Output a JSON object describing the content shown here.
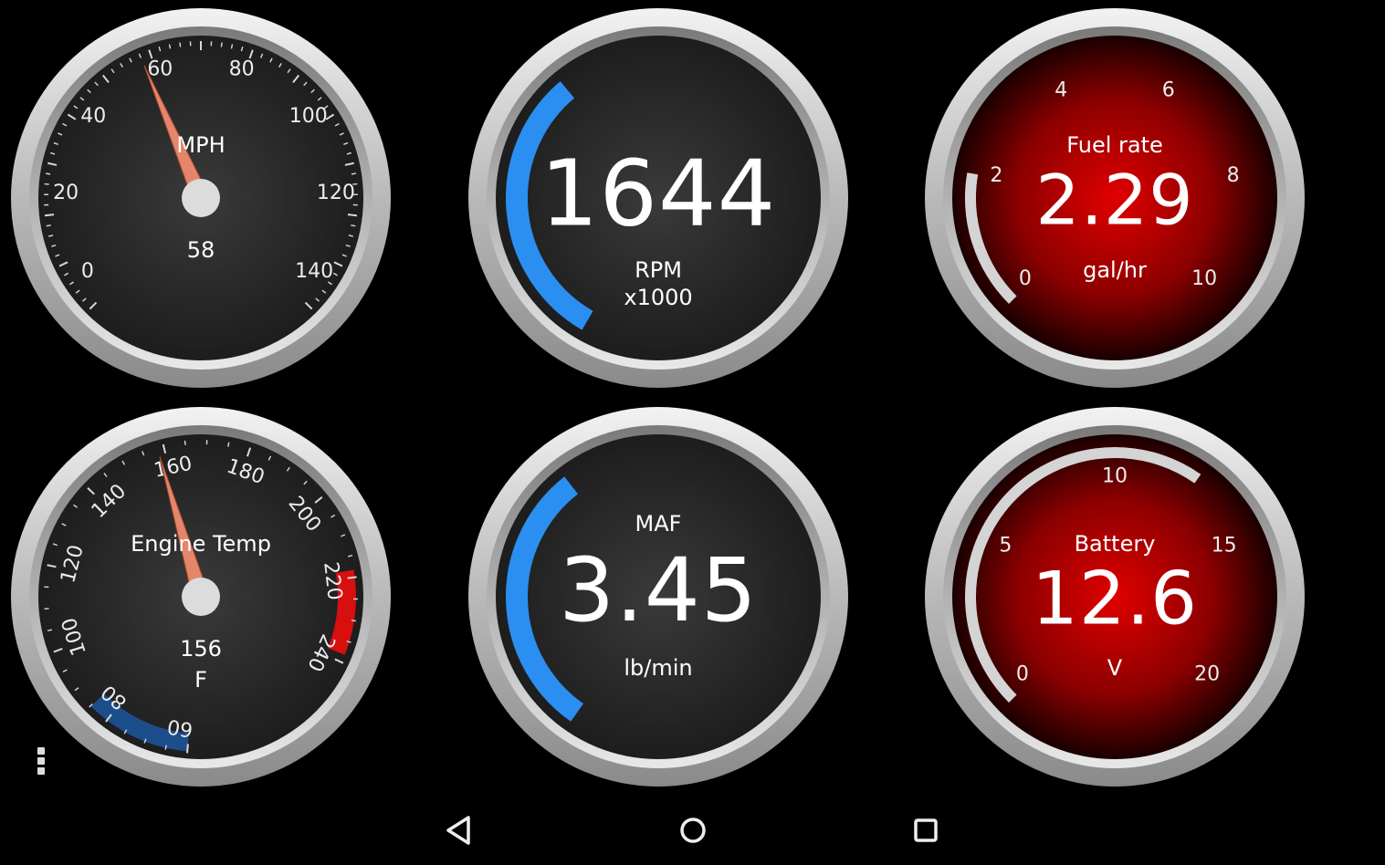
{
  "gauges": {
    "speed": {
      "label": "MPH",
      "value": "58",
      "value_numeric": 58,
      "scale_min": 0,
      "scale_max": 140,
      "ticks": [
        "0",
        "20",
        "40",
        "60",
        "80",
        "100",
        "120",
        "140"
      ]
    },
    "rpm": {
      "value": "1644",
      "unit": "RPM",
      "multiplier": "x1000",
      "arc_fraction": 0.27
    },
    "fuel": {
      "label": "Fuel rate",
      "value": "2.29",
      "unit": "gal/hr",
      "ticks": [
        "0",
        "2",
        "4",
        "6",
        "8",
        "10"
      ],
      "value_numeric": 2.29,
      "scale_min": 0,
      "scale_max": 10
    },
    "engine_temp": {
      "label": "Engine Temp",
      "value": "156",
      "unit": "F",
      "value_numeric": 156,
      "scale_min": 60,
      "scale_max": 240,
      "ticks": [
        "60",
        "80",
        "100",
        "120",
        "140",
        "160",
        "180",
        "200",
        "220",
        "240"
      ]
    },
    "maf": {
      "label": "MAF",
      "value": "3.45",
      "unit": "lb/min",
      "arc_fraction": 0.27
    },
    "battery": {
      "label": "Battery",
      "value": "12.6",
      "unit": "V",
      "ticks": [
        "0",
        "5",
        "10",
        "15",
        "20"
      ],
      "value_numeric": 12.6,
      "scale_min": 0,
      "scale_max": 20
    }
  },
  "colors": {
    "accent_blue": "#2a8ff0",
    "needle": "#e3866c",
    "temp_cold": "#1c4e8c",
    "temp_hot": "#d80f0f",
    "red_dial": "#b00000",
    "bezel": "#c8c8c8"
  },
  "nav": {
    "back": "back-icon",
    "home": "home-icon",
    "recents": "recents-icon",
    "menu": "overflow-menu-icon"
  }
}
